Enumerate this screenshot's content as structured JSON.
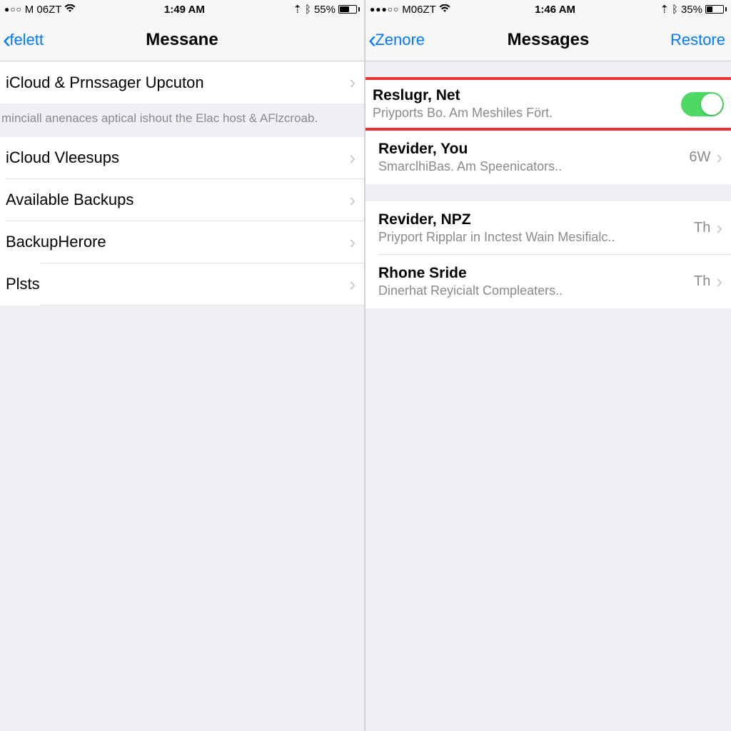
{
  "colors": {
    "accent": "#007aff",
    "toggle_on": "#4cd964",
    "highlight": "#e53530"
  },
  "left": {
    "status": {
      "signal": "●○○",
      "carrier": "M 06ZT",
      "time": "1:49 AM",
      "nav": "⇡",
      "battery_pct": "55%",
      "battery_fill": 55
    },
    "nav": {
      "back_label": "felett",
      "title": "Messane"
    },
    "rows": {
      "r1": "iCloud & Prnssager Upcuton",
      "footer": "minciall anenaces aptical ishout the Elac host & AFlzcroab.",
      "r2": "iCloud Vleesups",
      "r3": "Available Backups",
      "r4": "BackupHerore",
      "r5": "Plsts"
    }
  },
  "right": {
    "status": {
      "signal": "●●●○○",
      "carrier": "M06ZT",
      "time": "1:46 AM",
      "nav": "⇡",
      "battery_pct": "35%",
      "battery_fill": 35
    },
    "nav": {
      "back_label": "Zenore",
      "title": "Messages",
      "right_label": "Restore"
    },
    "rows": [
      {
        "title": "Reslugr, Net",
        "sub": "Priyports Bo. Am Meshiles Fört.",
        "toggle": true,
        "highlight": true
      },
      {
        "title": "Revider, You",
        "sub": "SmarclhiBas. Am Speenicators..",
        "meta": "6W"
      },
      {
        "title": "Revider, NPZ",
        "sub": "Priyport Ripplar in Inctest Wain Mesifialc..",
        "meta": "Th"
      },
      {
        "title": "Rhone Sride",
        "sub": "Dinerhat Reyicialt Compleaters..",
        "meta": "Th"
      }
    ]
  }
}
